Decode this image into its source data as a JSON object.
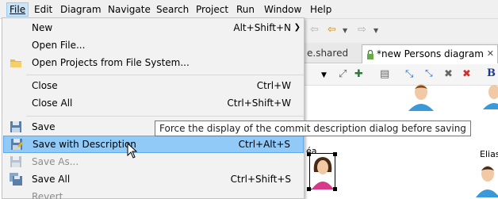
{
  "menubar": {
    "items": [
      "File",
      "Edit",
      "Diagram",
      "Navigate",
      "Search",
      "Project",
      "Run",
      "Window",
      "Help"
    ],
    "active": "File"
  },
  "file_menu": {
    "new": {
      "label": "New",
      "accel": "Alt+Shift+N"
    },
    "open_file": {
      "label": "Open File..."
    },
    "open_projects": {
      "label": "Open Projects from File System..."
    },
    "close": {
      "label": "Close",
      "accel": "Ctrl+W"
    },
    "close_all": {
      "label": "Close All",
      "accel": "Ctrl+Shift+W"
    },
    "save": {
      "label": "Save"
    },
    "save_with_description": {
      "label": "Save with Description",
      "accel": "Ctrl+Alt+S"
    },
    "save_as": {
      "label": "Save As..."
    },
    "save_all": {
      "label": "Save All",
      "accel": "Ctrl+Shift+S"
    },
    "revert": {
      "label": "Revert"
    }
  },
  "tooltip": {
    "text": "Force the display of the commit description dialog before saving"
  },
  "editor": {
    "tabs": [
      {
        "label": "e.shared"
      },
      {
        "label": "*new Persons diagram"
      }
    ],
    "canvas_labels": [
      "éa",
      "Elias"
    ]
  },
  "colors": {
    "highlight": "#91c9f7",
    "menu_bg": "#f2f2f2",
    "accent_blue": "#2f6fc9",
    "disabled_text": "#8d8d8d"
  }
}
